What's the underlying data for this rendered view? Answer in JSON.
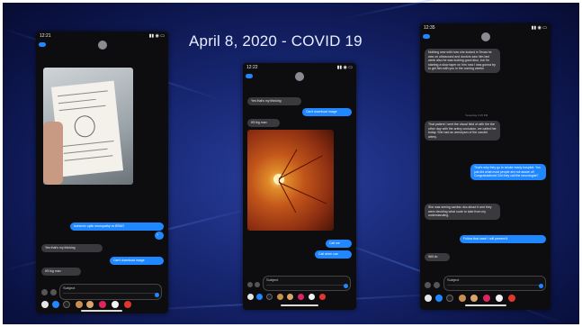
{
  "slide": {
    "title": "April 8, 2020 - COVID 19"
  },
  "phone_left": {
    "time": "12:21",
    "contact": "",
    "messages": [
      {
        "dir": "out",
        "text": "Ischemic optic neuropathy vs BRAO"
      },
      {
        "dir": "out",
        "text": "?"
      },
      {
        "dir": "in",
        "text": "Yes that's my thinking"
      },
      {
        "dir": "out",
        "text": "Can't download image"
      },
      {
        "dir": "in",
        "text": "It'll big man"
      }
    ],
    "input": {
      "subject": "Subject",
      "message": ""
    }
  },
  "phone_middle": {
    "time": "12:22",
    "contact": "",
    "messages": [
      {
        "dir": "in",
        "text": "Yes that's my thinking"
      },
      {
        "dir": "out",
        "text": "Can't download image"
      },
      {
        "dir": "in",
        "text": "It'll big man"
      },
      {
        "dir": "out",
        "text": "Call me"
      },
      {
        "dir": "out",
        "text": "Call when can"
      }
    ],
    "input": {
      "subject": "Subject",
      "message": ""
    }
  },
  "phone_right": {
    "time": "12:35",
    "contact": "",
    "messages": [
      {
        "dir": "in",
        "text": "Nothing new with how she looked in Texas he was on ultrasound and doctors saw him last week also he was looking good also, but I'm starting a slow taper on him now I was gonna try to get him with you in the coming weeks"
      },
      {
        "dir": "in",
        "text": "That patient I sent the visual field of with the the other day with the artery occlusion, we called her today. She had an aneurysm of the carotid artery."
      },
      {
        "dir": "out",
        "text": "That's why they go to stroke ready hospital. You just did what most people are not aware of! Congratulations! Did they call the neurologist?"
      },
      {
        "dir": "in",
        "text": "She was seeing cardiac doc about it and they were deciding what route to take from my understanding."
      },
      {
        "dir": "out",
        "text": "Follow that case! I will present it"
      },
      {
        "dir": "in",
        "text": "Will do"
      }
    ],
    "timestamps": [
      "Yesterday 3:15 PM"
    ],
    "input": {
      "subject": "Subject",
      "message": ""
    }
  }
}
